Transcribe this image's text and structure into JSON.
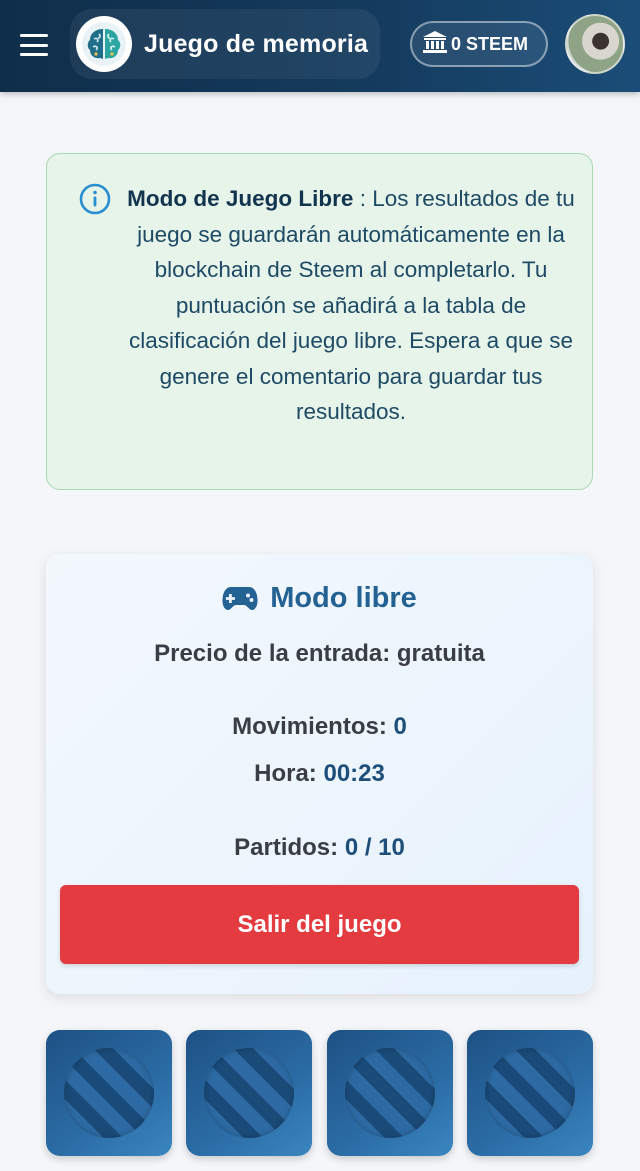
{
  "header": {
    "title": "Juego de memoria",
    "wallet_balance": "0 STEEM",
    "icons": {
      "menu": "hamburger-menu-icon",
      "logo": "brain-logo-icon",
      "wallet": "bank-icon",
      "avatar": "user-avatar"
    }
  },
  "info": {
    "icon": "info-circle-icon",
    "mode_label": "Modo de Juego Libre",
    "message": " : Los resultados de tu juego se guardarán automáticamente en la blockchain de Steem al completarlo. Tu puntuación se añadirá a la tabla de clasificación del juego libre. Espera a que se genere el comentario para guardar tus resultados."
  },
  "game": {
    "title": "Modo libre",
    "title_icon": "gamepad-icon",
    "entry_price": "Precio de la entrada: gratuita",
    "moves_label": "Movimientos: ",
    "moves_value": "0",
    "time_label": "Hora: ",
    "time_value": "00:23",
    "matches_label": "Partidos: ",
    "matches_value": "0 / 10",
    "exit_button": "Salir del juego"
  },
  "board": {
    "tile_icon": "card-back-striped-disc",
    "tiles_visible": 4
  },
  "colors": {
    "header_bg": "#143a5c",
    "info_bg": "#e6f4e9",
    "accent_blue": "#246294",
    "exit_red": "#e33b3f",
    "tile_blue": "#2b6ca5"
  }
}
